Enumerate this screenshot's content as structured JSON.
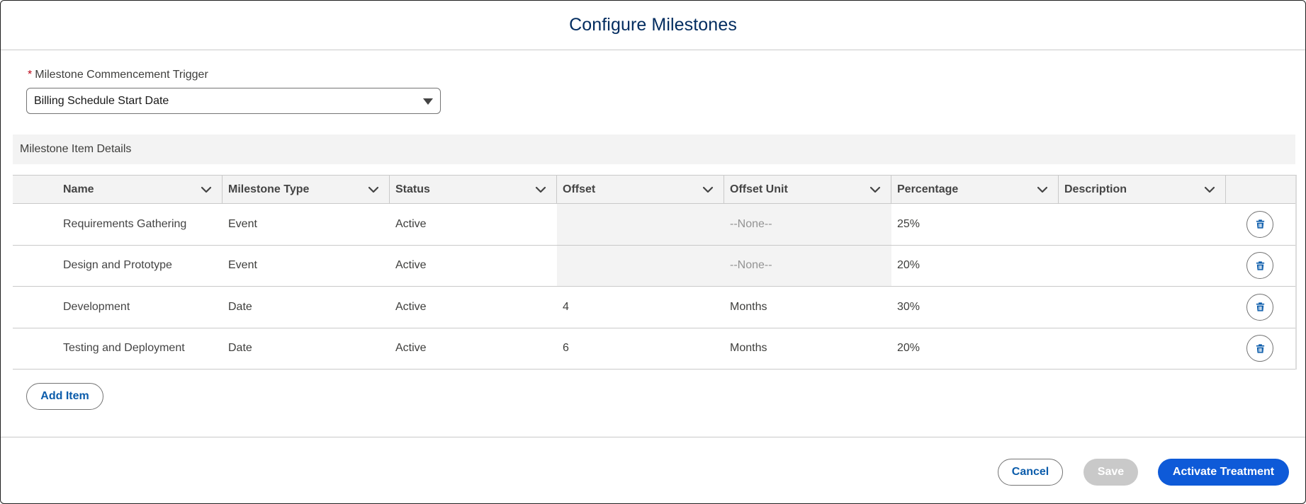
{
  "modal": {
    "title": "Configure Milestones"
  },
  "trigger": {
    "label": "Milestone Commencement Trigger",
    "required_mark": "*",
    "value": "Billing Schedule Start Date"
  },
  "section": {
    "title": "Milestone Item Details"
  },
  "table": {
    "columns": [
      "Name",
      "Milestone Type",
      "Status",
      "Offset",
      "Offset Unit",
      "Percentage",
      "Description"
    ],
    "rows": [
      {
        "name": "Requirements Gathering",
        "type": "Event",
        "status": "Active",
        "offset": "",
        "offset_unit": "--None--",
        "percentage": "25%",
        "description": "",
        "readonly_offset": true
      },
      {
        "name": "Design and Prototype",
        "type": "Event",
        "status": "Active",
        "offset": "",
        "offset_unit": "--None--",
        "percentage": "20%",
        "description": "",
        "readonly_offset": true
      },
      {
        "name": "Development",
        "type": "Date",
        "status": "Active",
        "offset": "4",
        "offset_unit": "Months",
        "percentage": "30%",
        "description": "",
        "readonly_offset": false
      },
      {
        "name": "Testing and Deployment",
        "type": "Date",
        "status": "Active",
        "offset": "6",
        "offset_unit": "Months",
        "percentage": "20%",
        "description": "",
        "readonly_offset": false
      }
    ]
  },
  "actions": {
    "add_item": "Add Item"
  },
  "footer": {
    "cancel": "Cancel",
    "save": "Save",
    "activate": "Activate Treatment"
  },
  "icons": {
    "row_action": "trash-icon",
    "column_menu": "chevron-down-icon",
    "combobox": "caret-down-icon"
  },
  "colors": {
    "brand": "#0b5cab",
    "title": "#032d60",
    "required": "#ba0517",
    "primary_button": "#0e5ad8"
  }
}
